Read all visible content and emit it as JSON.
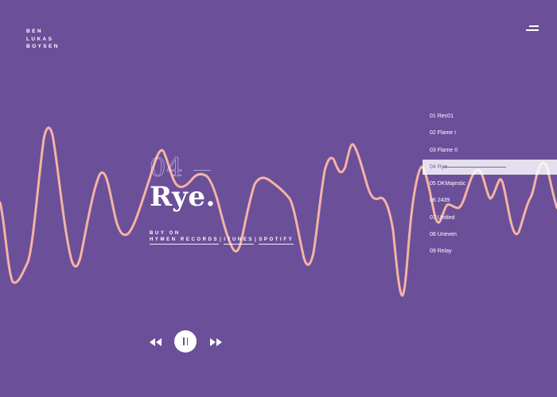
{
  "artist": {
    "lines": [
      "BEN",
      "LUKAS",
      "BOYSEN"
    ]
  },
  "menu": {
    "icon": "menu-icon"
  },
  "now_playing": {
    "number": "04",
    "title": "Rye.",
    "buy_label": "BUY ON",
    "buy_links": [
      "HYMEN RECORDS",
      "ITUNES",
      "SPOTIFY"
    ],
    "separator": "|"
  },
  "tracklist": [
    "01 Rec01",
    "02 Flame I",
    "03 Flame II",
    "04 Rye",
    "05 DKMajestic",
    "06 2439",
    "07 Untiled",
    "08 Uneven",
    "09 Relay"
  ],
  "active_track_index": 3,
  "player": {
    "prev_icon": "rewind-icon",
    "pause_icon": "pause-icon",
    "next_icon": "fast-forward-icon",
    "state": "playing"
  },
  "colors": {
    "background": "#6b4f99",
    "waveform": "#f6b3a5",
    "text": "#ffffff"
  }
}
